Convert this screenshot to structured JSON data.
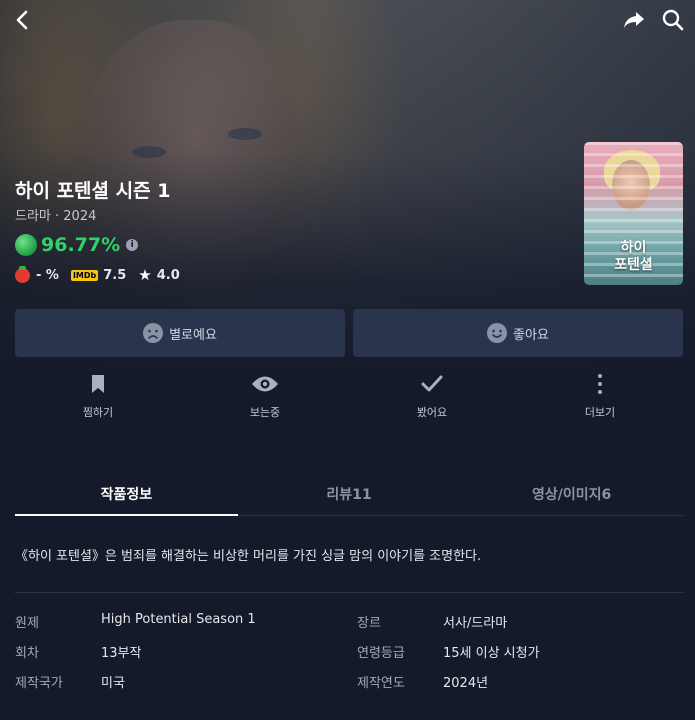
{
  "title": "하이 포텐셜 시즌 1",
  "meta": "드라마 · 2024",
  "score": "96.77%",
  "ratings": {
    "tomato": "- %",
    "imdb_badge": "IMDb",
    "imdb": "7.5",
    "star": "4.0"
  },
  "poster": {
    "line1": "하이",
    "line2": "포텐셜"
  },
  "votes": {
    "dislike": "별로예요",
    "like": "좋아요"
  },
  "actions": {
    "bookmark": "찜하기",
    "watching": "보는중",
    "watched": "봤어요",
    "more": "더보기"
  },
  "tabs": [
    "작품정보",
    "리뷰11",
    "영상/이미지6"
  ],
  "synopsis": "《하이 포텐셜》은 범죄를 해결하는 비상한 머리를 가진 싱글 맘의 이야기를 조명한다.",
  "details": [
    {
      "key": "원제",
      "value": "High Potential Season 1"
    },
    {
      "key": "장르",
      "value": "서사/드라마"
    },
    {
      "key": "회차",
      "value": "13부작"
    },
    {
      "key": "연령등급",
      "value": "15세 이상 시청가"
    },
    {
      "key": "제작국가",
      "value": "미국"
    },
    {
      "key": "제작연도",
      "value": "2024년"
    }
  ],
  "colors": {
    "background": "#141a2a",
    "score": "#2fd36a",
    "button": "#2b344d",
    "imdb": "#f5c518"
  }
}
